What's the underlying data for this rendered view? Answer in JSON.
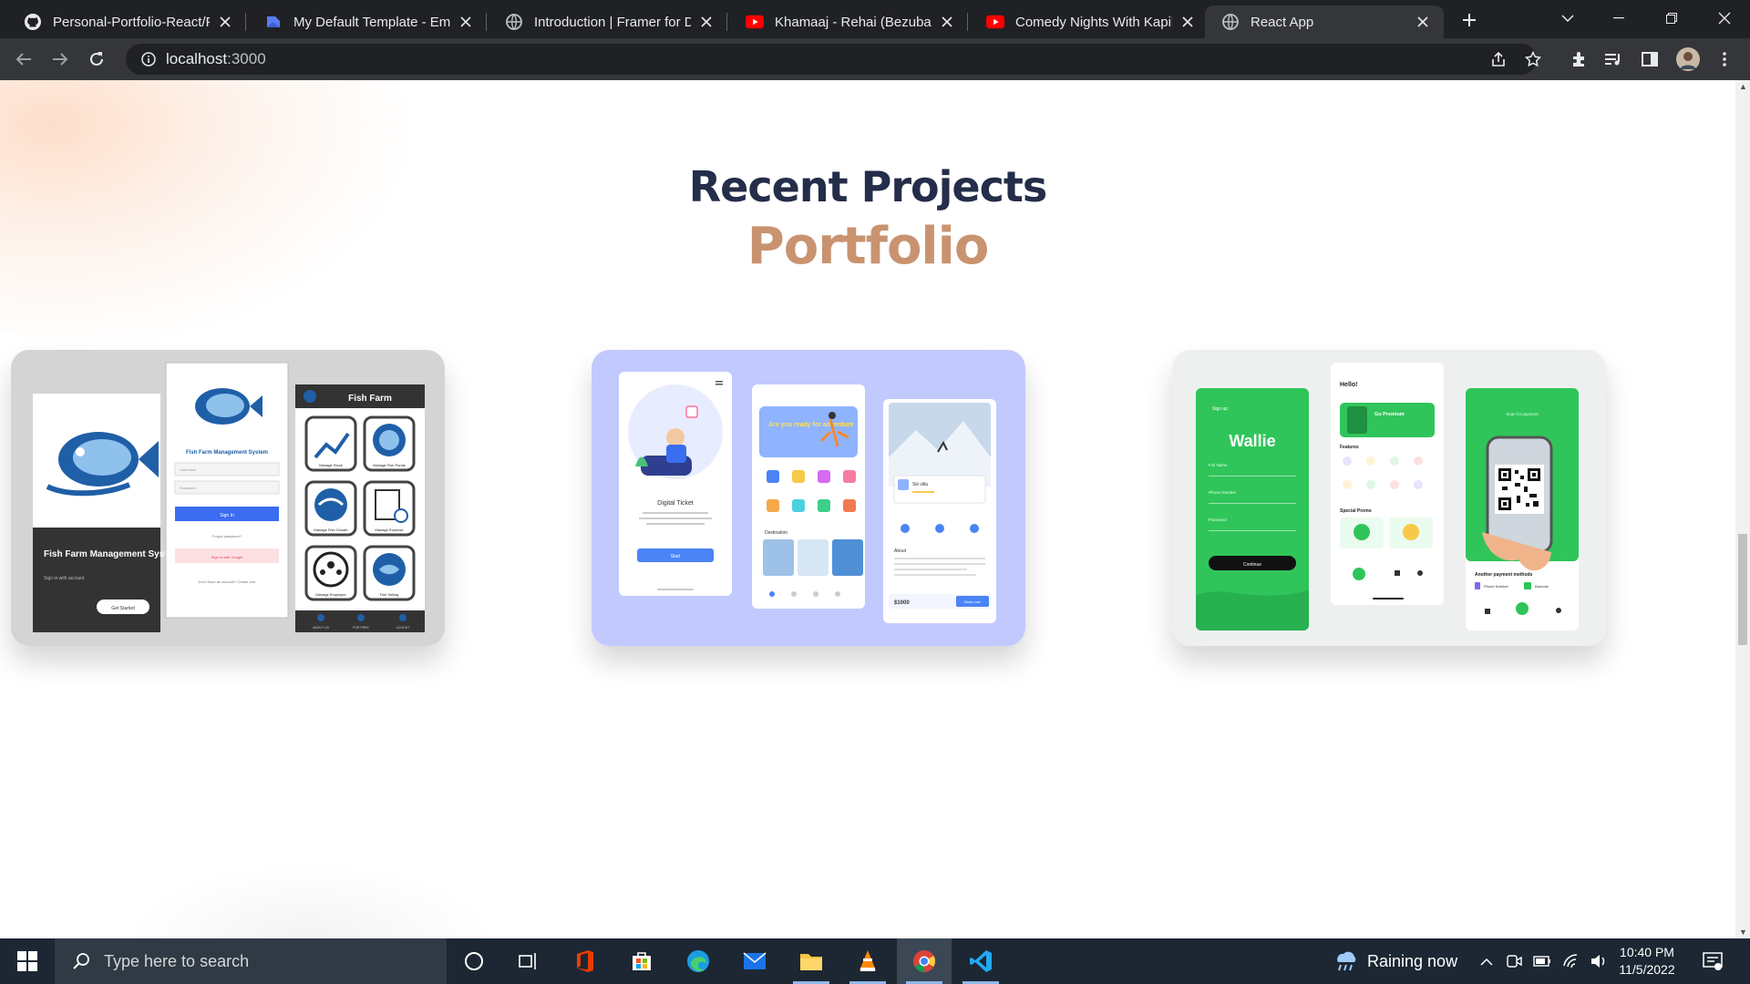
{
  "browser": {
    "tabs": [
      {
        "title": "Personal-Portfolio-React/Fo",
        "icon": "github-icon"
      },
      {
        "title": "My Default Template - Emai",
        "icon": "mail-template-icon"
      },
      {
        "title": "Introduction | Framer for De",
        "icon": "globe-icon"
      },
      {
        "title": "Khamaaj - Rehai (Bezubaan",
        "icon": "youtube-icon"
      },
      {
        "title": "Comedy Nights With Kapil",
        "icon": "youtube-icon"
      },
      {
        "title": "React App",
        "icon": "globe-icon"
      }
    ],
    "active_tab": "React App",
    "address": {
      "host": "localhost",
      "port": ":3000"
    }
  },
  "page": {
    "heading": "Recent Projects",
    "subheading": "Portfolio",
    "projects": [
      {
        "name": "fish-farm",
        "screen_title": "Fish Farm Management System",
        "screen_subtitle": "Sign in with account",
        "cta": "Get Started",
        "login_title": "Fish Farm Management System",
        "login_fields": [
          "Username",
          "Password"
        ],
        "login_button": "Sign In",
        "forgot": "Forgot password?",
        "google": "Sign in with Google",
        "signup": "Don't have an account? Create one",
        "dashboard_title": "Fish Farm",
        "tiles": [
          "Manage Stock",
          "Manage Fish Ponds",
          "Manage Fish Growth",
          "Manage Expense",
          "Manage Employee",
          "Fish Selling"
        ],
        "nav": [
          "ABOUT US",
          "FOR FREE",
          "LOGOUT"
        ]
      },
      {
        "name": "travel",
        "ticket_title": "Digital Ticket",
        "ticket_button": "Start",
        "hero_text": "Are you ready for adventure",
        "section": "Destination",
        "detail_title": "Ski villa",
        "about": "About",
        "price": "$1000",
        "book": "Book now"
      },
      {
        "name": "wallie",
        "signup_label": "Sign up",
        "brand": "Wallie",
        "fields": [
          "Full Name",
          "Phone Number",
          "Password"
        ],
        "continue": "Continue",
        "hello": "Hello!",
        "premium": "Go Premium",
        "features": "Features",
        "promo": "Special Promo",
        "scan": "Scan for payment",
        "other": "Another payment methods",
        "methods": [
          "Phone Number",
          "Barcode"
        ]
      }
    ]
  },
  "taskbar": {
    "search_placeholder": "Type here to search",
    "weather": "Raining now",
    "time": "10:40 PM",
    "date": "11/5/2022"
  },
  "colors": {
    "heading": "#242d49",
    "accent": "#c99370",
    "travel_bg": "#c2c9ff",
    "wallie_green": "#2fc55a",
    "fish_blue": "#1f5fa8"
  }
}
